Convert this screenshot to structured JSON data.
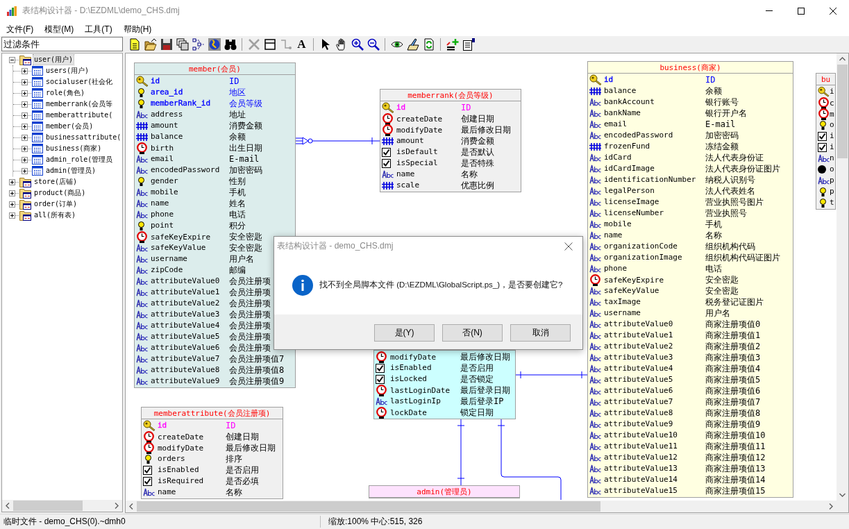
{
  "window": {
    "title": "表结构设计器 - D:\\EZDML\\demo_CHS.dmj"
  },
  "menu": [
    "文件(F)",
    "模型(M)",
    "工具(T)",
    "帮助(H)"
  ],
  "filter": {
    "placeholder": "过滤条件"
  },
  "tree": [
    {
      "label": "user(用户)",
      "expanded": true,
      "selected": true,
      "children": [
        {
          "label": "users(用户)",
          "expanded": false,
          "selected": false
        },
        {
          "label": "socialuser(社会化",
          "expanded": false,
          "selected": false
        },
        {
          "label": "role(角色)",
          "expanded": false,
          "selected": false
        },
        {
          "label": "memberrank(会员等",
          "expanded": false,
          "selected": false
        },
        {
          "label": "memberattribute(",
          "expanded": false,
          "selected": false
        },
        {
          "label": "member(会员)",
          "expanded": false,
          "selected": false
        },
        {
          "label": "businessattribute(",
          "expanded": false,
          "selected": false
        },
        {
          "label": "business(商家)",
          "expanded": false,
          "selected": false
        },
        {
          "label": "admin_role(管理员",
          "expanded": false,
          "selected": false
        },
        {
          "label": "admin(管理员)",
          "expanded": false,
          "selected": false
        }
      ]
    },
    {
      "label": "store(店铺)",
      "expanded": false,
      "selected": false
    },
    {
      "label": "product(商品)",
      "expanded": false,
      "selected": false
    },
    {
      "label": "order(订单)",
      "expanded": false,
      "selected": false
    },
    {
      "label": "all(所有表)",
      "expanded": false,
      "selected": false
    }
  ],
  "toolbar": {
    "text_button": "A"
  },
  "diagram": {
    "tables": [
      {
        "title": "member(会员)",
        "color": "#dcedec",
        "fields": [
          {
            "kind": "key",
            "name": "id",
            "comment": "ID",
            "color": "#0000ff"
          },
          {
            "kind": "bulb",
            "name": "area_id",
            "comment": "地区",
            "color": "#0000ff"
          },
          {
            "kind": "bulb",
            "name": "memberRank_id",
            "comment": "会员等级",
            "color": "#0000ff"
          },
          {
            "kind": "text",
            "name": "address",
            "comment": "地址"
          },
          {
            "kind": "number",
            "name": "amount",
            "comment": "消费金额"
          },
          {
            "kind": "number",
            "name": "balance",
            "comment": "余额"
          },
          {
            "kind": "date",
            "name": "birth",
            "comment": "出生日期"
          },
          {
            "kind": "text",
            "name": "email",
            "comment": "E-mail"
          },
          {
            "kind": "text",
            "name": "encodedPassword",
            "comment": "加密密码"
          },
          {
            "kind": "bulb",
            "name": "gender",
            "comment": "性别"
          },
          {
            "kind": "text",
            "name": "mobile",
            "comment": "手机"
          },
          {
            "kind": "text",
            "name": "name",
            "comment": "姓名"
          },
          {
            "kind": "text",
            "name": "phone",
            "comment": "电话"
          },
          {
            "kind": "bulb",
            "name": "point",
            "comment": "积分"
          },
          {
            "kind": "date",
            "name": "safeKeyExpire",
            "comment": "安全密匙"
          },
          {
            "kind": "text",
            "name": "safeKeyValue",
            "comment": "安全密匙"
          },
          {
            "kind": "text",
            "name": "username",
            "comment": "用户名"
          },
          {
            "kind": "text",
            "name": "zipCode",
            "comment": "邮编"
          },
          {
            "kind": "text",
            "name": "attributeValue0",
            "comment": "会员注册项"
          },
          {
            "kind": "text",
            "name": "attributeValue1",
            "comment": "会员注册项"
          },
          {
            "kind": "text",
            "name": "attributeValue2",
            "comment": "会员注册项"
          },
          {
            "kind": "text",
            "name": "attributeValue3",
            "comment": "会员注册项"
          },
          {
            "kind": "text",
            "name": "attributeValue4",
            "comment": "会员注册项"
          },
          {
            "kind": "text",
            "name": "attributeValue5",
            "comment": "会员注册项"
          },
          {
            "kind": "text",
            "name": "attributeValue6",
            "comment": "会员注册项"
          },
          {
            "kind": "text",
            "name": "attributeValue7",
            "comment": "会员注册项值7"
          },
          {
            "kind": "text",
            "name": "attributeValue8",
            "comment": "会员注册项值8"
          },
          {
            "kind": "text",
            "name": "attributeValue9",
            "comment": "会员注册项值9"
          }
        ]
      },
      {
        "title": "memberrank(会员等级)",
        "color": "#f0f0f0",
        "fields": [
          {
            "kind": "key",
            "name": "id",
            "comment": "ID",
            "color": "#ff00ff"
          },
          {
            "kind": "date",
            "name": "createDate",
            "comment": "创建日期"
          },
          {
            "kind": "date",
            "name": "modifyDate",
            "comment": "最后修改日期"
          },
          {
            "kind": "number",
            "name": "amount",
            "comment": "消费金额"
          },
          {
            "kind": "bool",
            "name": "isDefault",
            "comment": "是否默认"
          },
          {
            "kind": "bool",
            "name": "isSpecial",
            "comment": "是否特殊"
          },
          {
            "kind": "text",
            "name": "name",
            "comment": "名称"
          },
          {
            "kind": "number",
            "name": "scale",
            "comment": "优惠比例"
          }
        ]
      },
      {
        "title": "business(商家)",
        "color": "#ffffe1",
        "fields": [
          {
            "kind": "key",
            "name": "id",
            "comment": "ID",
            "color": "#0000ff"
          },
          {
            "kind": "number",
            "name": "balance",
            "comment": "余额"
          },
          {
            "kind": "text",
            "name": "bankAccount",
            "comment": "银行账号"
          },
          {
            "kind": "text",
            "name": "bankName",
            "comment": "银行开户名"
          },
          {
            "kind": "text",
            "name": "email",
            "comment": "E-mail"
          },
          {
            "kind": "text",
            "name": "encodedPassword",
            "comment": "加密密码"
          },
          {
            "kind": "number",
            "name": "frozenFund",
            "comment": "冻结金额"
          },
          {
            "kind": "text",
            "name": "idCard",
            "comment": "法人代表身份证"
          },
          {
            "kind": "text",
            "name": "idCardImage",
            "comment": "法人代表身份证图片"
          },
          {
            "kind": "text",
            "name": "identificationNumber",
            "comment": "纳税人识别号"
          },
          {
            "kind": "text",
            "name": "legalPerson",
            "comment": "法人代表姓名"
          },
          {
            "kind": "text",
            "name": "licenseImage",
            "comment": "营业执照号图片"
          },
          {
            "kind": "text",
            "name": "licenseNumber",
            "comment": "营业执照号"
          },
          {
            "kind": "text",
            "name": "mobile",
            "comment": "手机"
          },
          {
            "kind": "text",
            "name": "name",
            "comment": "名称"
          },
          {
            "kind": "text",
            "name": "organizationCode",
            "comment": "组织机构代码"
          },
          {
            "kind": "text",
            "name": "organizationImage",
            "comment": "组织机构代码证图片"
          },
          {
            "kind": "text",
            "name": "phone",
            "comment": "电话"
          },
          {
            "kind": "date",
            "name": "safeKeyExpire",
            "comment": "安全密匙"
          },
          {
            "kind": "text",
            "name": "safeKeyValue",
            "comment": "安全密匙"
          },
          {
            "kind": "text",
            "name": "taxImage",
            "comment": "税务登记证图片"
          },
          {
            "kind": "text",
            "name": "username",
            "comment": "用户名"
          },
          {
            "kind": "text",
            "name": "attributeValue0",
            "comment": "商家注册项值0"
          },
          {
            "kind": "text",
            "name": "attributeValue1",
            "comment": "商家注册项值1"
          },
          {
            "kind": "text",
            "name": "attributeValue2",
            "comment": "商家注册项值2"
          },
          {
            "kind": "text",
            "name": "attributeValue3",
            "comment": "商家注册项值3"
          },
          {
            "kind": "text",
            "name": "attributeValue4",
            "comment": "商家注册项值4"
          },
          {
            "kind": "text",
            "name": "attributeValue5",
            "comment": "商家注册项值5"
          },
          {
            "kind": "text",
            "name": "attributeValue6",
            "comment": "商家注册项值6"
          },
          {
            "kind": "text",
            "name": "attributeValue7",
            "comment": "商家注册项值7"
          },
          {
            "kind": "text",
            "name": "attributeValue8",
            "comment": "商家注册项值8"
          },
          {
            "kind": "text",
            "name": "attributeValue9",
            "comment": "商家注册项值9"
          },
          {
            "kind": "text",
            "name": "attributeValue10",
            "comment": "商家注册项值10"
          },
          {
            "kind": "text",
            "name": "attributeValue11",
            "comment": "商家注册项值11"
          },
          {
            "kind": "text",
            "name": "attributeValue12",
            "comment": "商家注册项值12"
          },
          {
            "kind": "text",
            "name": "attributeValue13",
            "comment": "商家注册项值13"
          },
          {
            "kind": "text",
            "name": "attributeValue14",
            "comment": "商家注册项值14"
          },
          {
            "kind": "text",
            "name": "attributeValue15",
            "comment": "商家注册项值15"
          }
        ]
      },
      {
        "color": "#ccffff",
        "fields": [
          {
            "kind": "date",
            "name": "modifyDate",
            "comment": "最后修改日期"
          },
          {
            "kind": "bool",
            "name": "isEnabled",
            "comment": "是否启用"
          },
          {
            "kind": "bool",
            "name": "isLocked",
            "comment": "是否锁定"
          },
          {
            "kind": "date",
            "name": "lastLoginDate",
            "comment": "最后登录日期"
          },
          {
            "kind": "text",
            "name": "lastLoginIp",
            "comment": "最后登录IP"
          },
          {
            "kind": "date",
            "name": "lockDate",
            "comment": "锁定日期"
          }
        ]
      },
      {
        "title": "memberattribute(会员注册项)",
        "color": "#f0f0f0",
        "fields": [
          {
            "kind": "key",
            "name": "id",
            "comment": "ID",
            "color": "#ff00ff"
          },
          {
            "kind": "date",
            "name": "createDate",
            "comment": "创建日期"
          },
          {
            "kind": "date",
            "name": "modifyDate",
            "comment": "最后修改日期"
          },
          {
            "kind": "bulb",
            "name": "orders",
            "comment": "排序"
          },
          {
            "kind": "bool",
            "name": "isEnabled",
            "comment": "是否启用"
          },
          {
            "kind": "bool",
            "name": "isRequired",
            "comment": "是否必填"
          },
          {
            "kind": "text",
            "name": "name",
            "comment": "名称"
          }
        ]
      },
      {
        "title": "admin(管理员)",
        "color": "#fde2fd"
      },
      {
        "title": "bu",
        "color": "#f0f0f0",
        "fields": [
          {
            "kind": "key",
            "name": "i"
          },
          {
            "kind": "date",
            "name": "c"
          },
          {
            "kind": "date",
            "name": "m"
          },
          {
            "kind": "bulb",
            "name": "o"
          },
          {
            "kind": "bool",
            "name": "i"
          },
          {
            "kind": "bool",
            "name": "i"
          },
          {
            "kind": "text",
            "name": "n"
          },
          {
            "kind": "dot",
            "name": "o"
          },
          {
            "kind": "text",
            "name": "p"
          },
          {
            "kind": "bulb",
            "name": "p"
          },
          {
            "kind": "bulb",
            "name": "t"
          }
        ]
      }
    ]
  },
  "dialog": {
    "title": "表结构设计器 - demo_CHS.dmj",
    "message": "找不到全局脚本文件 (D:\\EZDML\\GlobalScript.ps_)，是否要创建它?",
    "buttons": [
      "是(Y)",
      "否(N)",
      "取消"
    ]
  },
  "status_bar": [
    "临时文件 - demo_CHS(0).~dmh0",
    "缩放:100% 中心:515, 326"
  ]
}
